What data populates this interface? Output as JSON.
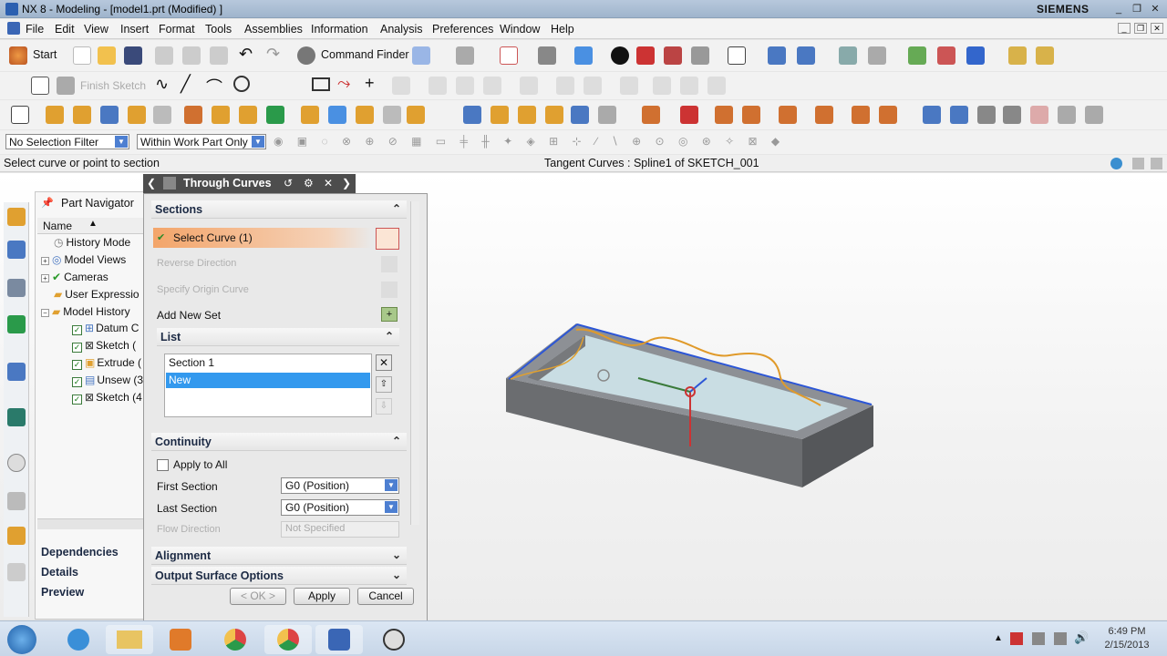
{
  "window": {
    "title": "NX 8 - Modeling - [model1.prt (Modified) ]",
    "brand": "SIEMENS"
  },
  "menu": [
    "File",
    "Edit",
    "View",
    "Insert",
    "Format",
    "Tools",
    "Assemblies",
    "Information",
    "Analysis",
    "Preferences",
    "Window",
    "Help"
  ],
  "toolbar": {
    "start_label": "Start",
    "command_finder_label": "Command Finder",
    "finish_sketch_label": "Finish Sketch"
  },
  "selection": {
    "filter": "No Selection Filter",
    "scope": "Within Work Part Only"
  },
  "status": {
    "prompt": "Select curve or point to section",
    "info": "Tangent Curves : Spline1 of SKETCH_001"
  },
  "navigator": {
    "title": "Part Navigator",
    "column": "Name",
    "items": [
      {
        "label": "History Mode",
        "indent": 0
      },
      {
        "label": "Model Views",
        "indent": 0
      },
      {
        "label": "Cameras",
        "indent": 0
      },
      {
        "label": "User Expressio",
        "indent": 0
      },
      {
        "label": "Model History",
        "indent": 0
      },
      {
        "label": "Datum C",
        "indent": 1
      },
      {
        "label": "Sketch (",
        "indent": 1
      },
      {
        "label": "Extrude (",
        "indent": 1
      },
      {
        "label": "Unsew (3",
        "indent": 1
      },
      {
        "label": "Sketch (4",
        "indent": 1
      }
    ],
    "panels": [
      "Dependencies",
      "Details",
      "Preview"
    ]
  },
  "dialog": {
    "title": "Through Curves",
    "sections_header": "Sections",
    "select_curve": "Select Curve (1)",
    "reverse_direction": "Reverse Direction",
    "specify_origin": "Specify Origin Curve",
    "add_new_set": "Add New Set",
    "list_header": "List",
    "list_items": [
      "Section  1",
      "New"
    ],
    "continuity_header": "Continuity",
    "apply_to_all": "Apply to All",
    "first_section_label": "First Section",
    "first_section_value": "G0 (Position)",
    "last_section_label": "Last Section",
    "last_section_value": "G0 (Position)",
    "flow_direction_label": "Flow Direction",
    "flow_direction_value": "Not Specified",
    "alignment_header": "Alignment",
    "output_header": "Output Surface Options",
    "ok": "< OK >",
    "apply": "Apply",
    "cancel": "Cancel"
  },
  "clock": {
    "time": "6:49 PM",
    "date": "2/15/2013"
  }
}
